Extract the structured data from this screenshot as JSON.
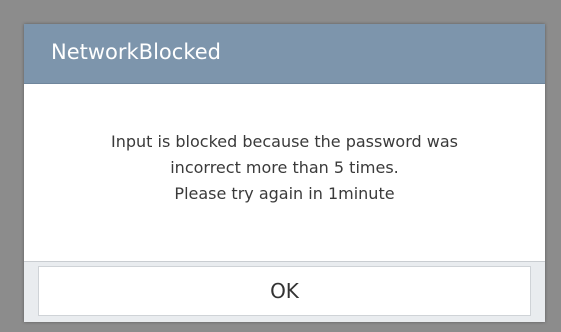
{
  "dialog": {
    "title": "NetworkBlocked",
    "message_lines": [
      "Input is blocked because the password was",
      "incorrect more than 5 times.",
      "Please try again in 1minute"
    ],
    "ok_label": "OK"
  },
  "colors": {
    "backdrop": "#8c8c8c",
    "header": "#7d95ac",
    "title_text": "#ffffff",
    "body": "#ffffff",
    "message_text": "#3a3a3a",
    "footer": "#e9ecef",
    "button": "#ffffff"
  }
}
